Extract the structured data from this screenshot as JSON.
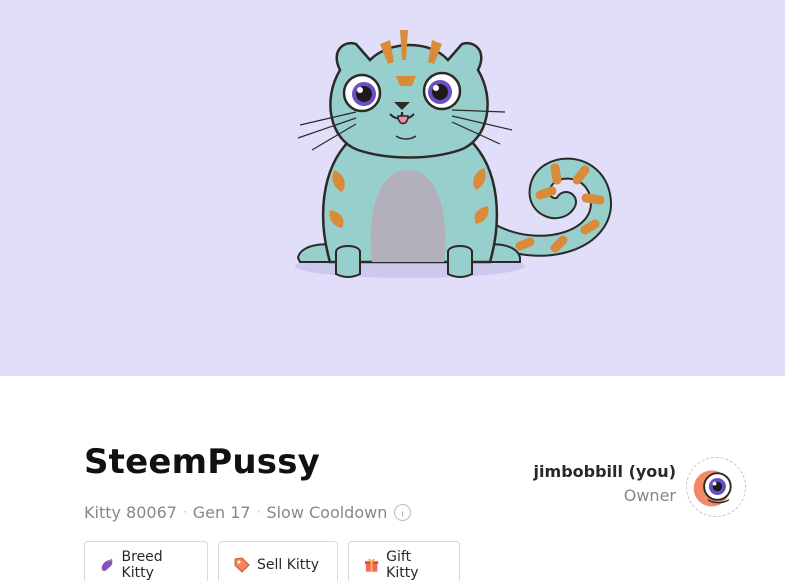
{
  "kitty": {
    "name": "SteemPussy",
    "id_label": "Kitty 80067",
    "generation": "Gen 17",
    "cooldown": "Slow Cooldown"
  },
  "actions": {
    "breed_label": "Breed Kitty",
    "sell_label": "Sell Kitty",
    "gift_label": "Gift Kitty"
  },
  "owner": {
    "name": "jimbobbill (you)",
    "role": "Owner"
  },
  "colors": {
    "hero_background": "#e1defa",
    "cat_body": "#96cfcb",
    "cat_stripes": "#d98b3a",
    "cat_belly": "#b3b0bb",
    "eye_iris": "#6a4fc4"
  }
}
